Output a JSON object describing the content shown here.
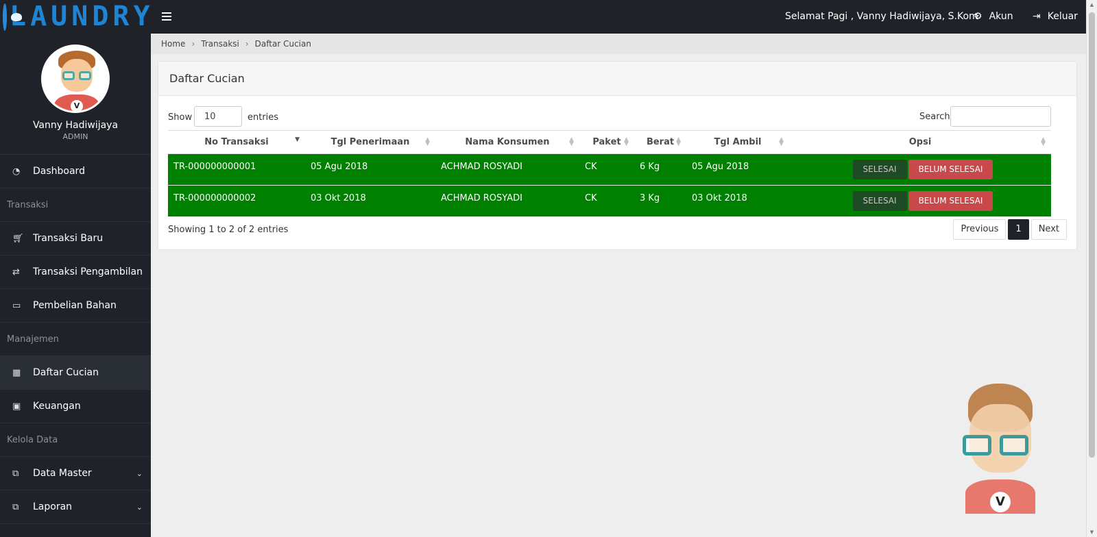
{
  "brand": {
    "name": "LAUNDRY",
    "logo_icon": "laundry-logo-icon"
  },
  "topbar": {
    "greeting": "Selamat Pagi , Vanny Hadiwijaya, S.Kom",
    "akun_label": "Akun",
    "keluar_label": "Keluar"
  },
  "profile": {
    "name": "Vanny Hadiwijaya",
    "role": "ADMIN",
    "avatar_letter": "V"
  },
  "sidebar": {
    "dashboard": "Dashboard",
    "section_transaksi": "Transaksi",
    "transaksi_baru": "Transaksi Baru",
    "transaksi_pengambilan": "Transaksi Pengambilan",
    "pembelian_bahan": "Pembelian Bahan",
    "section_manajemen": "Manajemen",
    "daftar_cucian": "Daftar Cucian",
    "keuangan": "Keuangan",
    "section_kelola": "Kelola Data",
    "data_master": "Data Master",
    "laporan": "Laporan"
  },
  "breadcrumb": {
    "home": "Home",
    "transaksi": "Transaksi",
    "current": "Daftar Cucian"
  },
  "panel": {
    "title": "Daftar Cucian"
  },
  "table_controls": {
    "show_label": "Show",
    "entries_value": "10",
    "entries_label": "entries",
    "search_label": "Search:"
  },
  "table": {
    "columns": [
      "No Transaksi",
      "Tgl Penerimaan",
      "Nama Konsumen",
      "Paket",
      "Berat",
      "Tgl Ambil",
      "Opsi"
    ],
    "rows": [
      {
        "no": "TR-000000000001",
        "tgl_terima": "05 Agu 2018",
        "nama": "ACHMAD ROSYADI",
        "paket": "CK",
        "berat": "6 Kg",
        "tgl_ambil": "05 Agu 2018"
      },
      {
        "no": "TR-000000000002",
        "tgl_terima": "03 Okt 2018",
        "nama": "ACHMAD ROSYADI",
        "paket": "CK",
        "berat": "3 Kg",
        "tgl_ambil": "03 Okt 2018"
      }
    ],
    "btn_done": "SELESAI",
    "btn_notdone": "BELUM SELESAI",
    "row_color": "#008000"
  },
  "footer": {
    "showing": "Showing 1 to 2 of 2 entries",
    "previous": "Previous",
    "page": "1",
    "next": "Next"
  },
  "mascot": {
    "letter": "V"
  }
}
